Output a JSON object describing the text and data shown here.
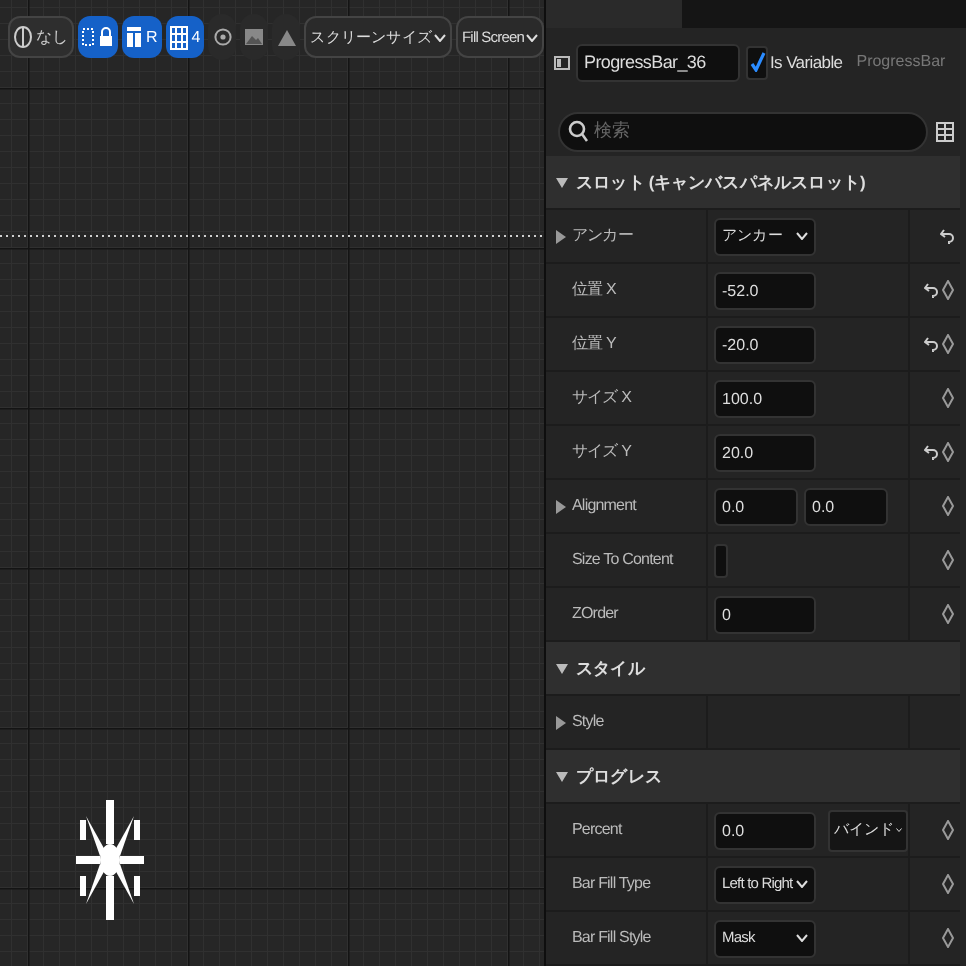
{
  "toolbar": [
    {
      "kind": "toggle",
      "label": "なし",
      "active": false
    },
    {
      "kind": "toggle",
      "active": true
    },
    {
      "kind": "toggle",
      "label": "R",
      "active": true
    },
    {
      "kind": "toggle",
      "label": "4",
      "active": true
    },
    {
      "kind": "icon",
      "active": false
    },
    {
      "kind": "icon",
      "active": false
    },
    {
      "kind": "icon",
      "active": false
    },
    {
      "kind": "dropdown",
      "label": "スクリーンサイズ"
    },
    {
      "kind": "dropdown",
      "label": "Fill Screen"
    }
  ],
  "details": {
    "name": "ProgressBar_36",
    "is_variable": {
      "label": "Is Variable",
      "checked": true
    },
    "type_label": "ProgressBar",
    "search": {
      "placeholder": "検索"
    }
  },
  "rows": [
    {
      "kind": "section",
      "label": "スロット (キャンバスパネルスロット)",
      "expanded": true
    },
    {
      "kind": "property",
      "label": "アンカー",
      "expandable": true,
      "controls": [
        {
          "kind": "dropdown",
          "value": "アンカー"
        }
      ],
      "reset": true,
      "keyframe": false
    },
    {
      "kind": "property",
      "label": "位置 X",
      "expandable": false,
      "controls": [
        {
          "kind": "number",
          "value": "-52.0"
        }
      ],
      "reset": true,
      "keyframe": true
    },
    {
      "kind": "property",
      "label": "位置 Y",
      "expandable": false,
      "controls": [
        {
          "kind": "number",
          "value": "-20.0"
        }
      ],
      "reset": true,
      "keyframe": true
    },
    {
      "kind": "property",
      "label": "サイズ X",
      "expandable": false,
      "controls": [
        {
          "kind": "number",
          "value": "100.0"
        }
      ],
      "reset": false,
      "keyframe": true
    },
    {
      "kind": "property",
      "label": "サイズ Y",
      "expandable": false,
      "controls": [
        {
          "kind": "number",
          "value": "20.0"
        }
      ],
      "reset": true,
      "keyframe": true
    },
    {
      "kind": "property",
      "label": "Alignment",
      "expandable": true,
      "controls": [
        {
          "kind": "small-number",
          "value": "0.0"
        },
        {
          "kind": "small-number",
          "value": "0.0"
        }
      ],
      "reset": false,
      "keyframe": true
    },
    {
      "kind": "property",
      "label": "Size To Content",
      "expandable": false,
      "controls": [
        {
          "kind": "checkbox",
          "checked": false
        }
      ],
      "reset": false,
      "keyframe": true
    },
    {
      "kind": "property",
      "label": "ZOrder",
      "expandable": false,
      "controls": [
        {
          "kind": "number",
          "value": "0"
        }
      ],
      "reset": false,
      "keyframe": true
    },
    {
      "kind": "section",
      "label": "スタイル",
      "expanded": true
    },
    {
      "kind": "property",
      "label": "Style",
      "expandable": true,
      "controls": [],
      "reset": false,
      "keyframe": false
    },
    {
      "kind": "section",
      "label": "プログレス",
      "expanded": true
    },
    {
      "kind": "property",
      "label": "Percent",
      "expandable": false,
      "controls": [
        {
          "kind": "number",
          "value": "0.0"
        },
        {
          "kind": "bind",
          "value": "バインド"
        }
      ],
      "reset": false,
      "keyframe": true
    },
    {
      "kind": "property",
      "label": "Bar Fill Type",
      "expandable": false,
      "controls": [
        {
          "kind": "dropdown",
          "value": "Left to Right"
        }
      ],
      "reset": false,
      "keyframe": true
    },
    {
      "kind": "property",
      "label": "Bar Fill Style",
      "expandable": false,
      "controls": [
        {
          "kind": "dropdown",
          "value": "Mask"
        }
      ],
      "reset": false,
      "keyframe": true
    }
  ]
}
